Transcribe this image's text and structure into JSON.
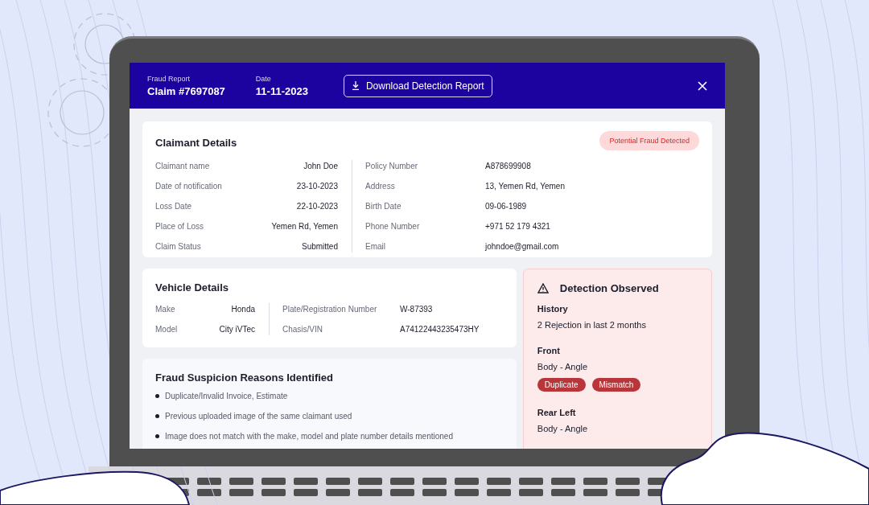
{
  "header": {
    "report_label": "Fraud Report",
    "claim": "Claim #7697087",
    "date_label": "Date",
    "date": "11-11-2023",
    "download_button": "Download Detection Report"
  },
  "claimant": {
    "title": "Claimant Details",
    "badge": "Potential Fraud Detected",
    "left": [
      {
        "label": "Claimant name",
        "value": "John Doe"
      },
      {
        "label": "Date of notification",
        "value": "23-10-2023"
      },
      {
        "label": "Loss Date",
        "value": "22-10-2023"
      },
      {
        "label": "Place of Loss",
        "value": "Yemen Rd, Yemen"
      },
      {
        "label": "Claim Status",
        "value": "Submitted"
      }
    ],
    "right": [
      {
        "label": "Policy Number",
        "value": "A878699908"
      },
      {
        "label": "Address",
        "value": "13, Yemen Rd, Yemen"
      },
      {
        "label": "Birth Date",
        "value": "09-06-1989"
      },
      {
        "label": "Phone Number",
        "value": "+971 52 179 4321"
      },
      {
        "label": "Email",
        "value": "johndoe@gmail.com"
      }
    ]
  },
  "vehicle": {
    "title": "Vehicle Details",
    "left": [
      {
        "label": "Make",
        "value": "Honda"
      },
      {
        "label": "Model",
        "value": "City iVTec"
      }
    ],
    "right": [
      {
        "label": "Plate/Registration Number",
        "value": "W-87393"
      },
      {
        "label": "Chasis/VIN",
        "value": "A74122443235473HY"
      }
    ]
  },
  "reasons": {
    "title": "Fraud Suspicion Reasons Identified",
    "items": [
      "Duplicate/Invalid Invoice, Estimate",
      "Previous uploaded image of the same claimant used",
      "Image does not match with the make, model and plate number details mentioned"
    ]
  },
  "detection": {
    "title": "Detection Observed",
    "sections": [
      {
        "heading": "History",
        "text": "2 Rejection in last 2 months"
      },
      {
        "heading": "Front",
        "text": "Body - Angle",
        "tags": [
          "Duplicate",
          "Mismatch"
        ]
      },
      {
        "heading": "Rear Left",
        "text": "Body - Angle"
      }
    ]
  }
}
